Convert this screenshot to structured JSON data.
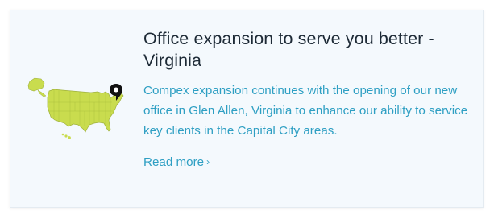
{
  "card": {
    "title": "Office expansion to serve you better - Virginia",
    "description": "Compex expansion continues with the opening of our new office in Glen Allen, Virginia to enhance our ability to service key clients in the Capital City areas.",
    "read_more_label": "Read more",
    "read_more_chevron": "›",
    "map_icon": "us-map-icon",
    "pin_icon": "location-pin-icon"
  },
  "colors": {
    "card_background": "#f4f9fd",
    "title": "#1d2a36",
    "accent_link": "#2e9fc3",
    "map_fill": "#c9dc4e",
    "pin": "#111111"
  }
}
